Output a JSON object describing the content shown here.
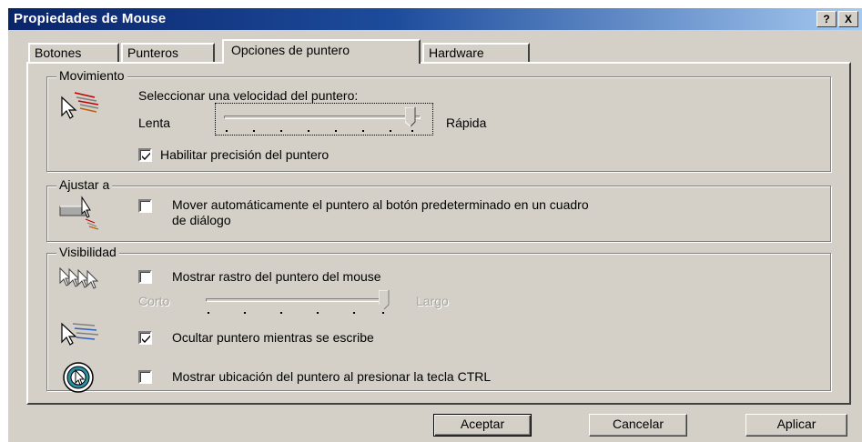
{
  "window": {
    "title": "Propiedades de Mouse",
    "help_button": "?",
    "close_button": "X"
  },
  "tabs": [
    {
      "label": "Botones"
    },
    {
      "label": "Punteros"
    },
    {
      "label": "Opciones de puntero"
    },
    {
      "label": "Hardware"
    }
  ],
  "movimiento": {
    "group_label": "Movimiento",
    "speed_label": "Seleccionar una velocidad del puntero:",
    "slow_label": "Lenta",
    "fast_label": "Rápida",
    "speed_level": 1.0,
    "precision_label": "Habilitar precisión del puntero",
    "precision_checked": true
  },
  "ajustar": {
    "group_label": "Ajustar a",
    "snap_label_line1": "Mover automáticamente el puntero al botón predeterminado en un cuadro",
    "snap_label_line2": "de diálogo",
    "snap_checked": false
  },
  "visibilidad": {
    "group_label": "Visibilidad",
    "trails_label": "Mostrar rastro del puntero del mouse",
    "trails_checked": false,
    "short_label": "Corto",
    "long_label": "Largo",
    "trail_level": 1.0,
    "hide_label": "Ocultar puntero mientras se escribe",
    "hide_checked": true,
    "ctrl_label": "Mostrar ubicación del puntero al presionar la tecla CTRL",
    "ctrl_checked": false
  },
  "buttons": {
    "ok": "Aceptar",
    "cancel": "Cancelar",
    "apply": "Aplicar"
  }
}
